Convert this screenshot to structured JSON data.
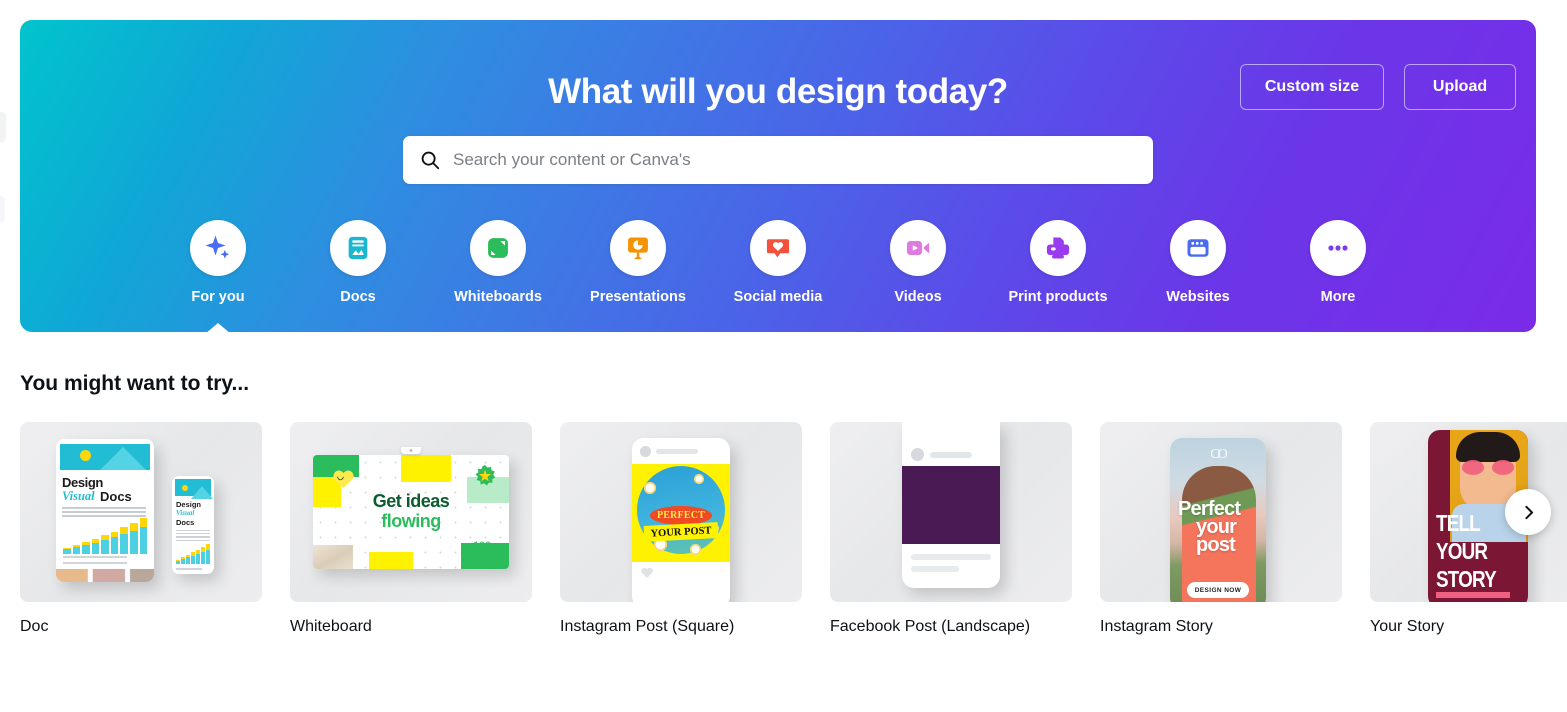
{
  "hero": {
    "title": "What will you design today?",
    "custom_size_label": "Custom size",
    "upload_label": "Upload",
    "gradient_start": "#00C4CC",
    "gradient_end": "#7A2BE8"
  },
  "search": {
    "placeholder": "Search your content or Canva's",
    "value": "",
    "icon": "search-icon"
  },
  "categories": [
    {
      "label": "For you",
      "icon": "sparkles-icon",
      "color": "#4B6DF5",
      "active": true
    },
    {
      "label": "Docs",
      "icon": "document-icon",
      "color": "#1AB7CE",
      "active": false
    },
    {
      "label": "Whiteboards",
      "icon": "whiteboard-icon",
      "color": "#2BBD5C",
      "active": false
    },
    {
      "label": "Presentations",
      "icon": "presentation-icon",
      "color": "#F59200",
      "active": false
    },
    {
      "label": "Social media",
      "icon": "heart-bubble-icon",
      "color": "#F4503C",
      "active": false
    },
    {
      "label": "Videos",
      "icon": "video-camera-icon",
      "color": "#DD7BE0",
      "active": false
    },
    {
      "label": "Print products",
      "icon": "printer-icon",
      "color": "#9A3BEF",
      "active": false
    },
    {
      "label": "Websites",
      "icon": "browser-window-icon",
      "color": "#4A6CF0",
      "active": false
    },
    {
      "label": "More",
      "icon": "ellipsis-icon",
      "color": "#7B3BE8",
      "active": false
    }
  ],
  "section": {
    "title": "You might want to try...",
    "next_icon": "chevron-right-icon"
  },
  "cards": [
    {
      "label": "Doc",
      "thumb": {
        "kind": "doc",
        "headline_1": "Design",
        "headline_2": "Visual",
        "headline_3": "Docs",
        "phone_headline_1": "Design",
        "phone_headline_2": "Visual",
        "phone_headline_3": "Docs"
      }
    },
    {
      "label": "Whiteboard",
      "thumb": {
        "kind": "whiteboard",
        "line_1": "Get ideas",
        "line_2": "flowing",
        "sticker_smile": ":)",
        "doodle": "100"
      }
    },
    {
      "label": "Instagram Post (Square)",
      "thumb": {
        "kind": "instagram-post",
        "badge": "PERFECT",
        "banner": "YOUR POST"
      }
    },
    {
      "label": "Facebook Post (Landscape)",
      "thumb": {
        "kind": "facebook-post",
        "image_color": "#4A1A54"
      }
    },
    {
      "label": "Instagram Story",
      "thumb": {
        "kind": "instagram-story",
        "logo": "CO",
        "line_1": "Perfect",
        "line_2": "your",
        "line_3": "post",
        "cta": "DESIGN NOW"
      }
    },
    {
      "label": "Your Story",
      "thumb": {
        "kind": "your-story",
        "line_1": "TELL",
        "line_2": "YOUR",
        "line_3": "STORY"
      }
    }
  ]
}
